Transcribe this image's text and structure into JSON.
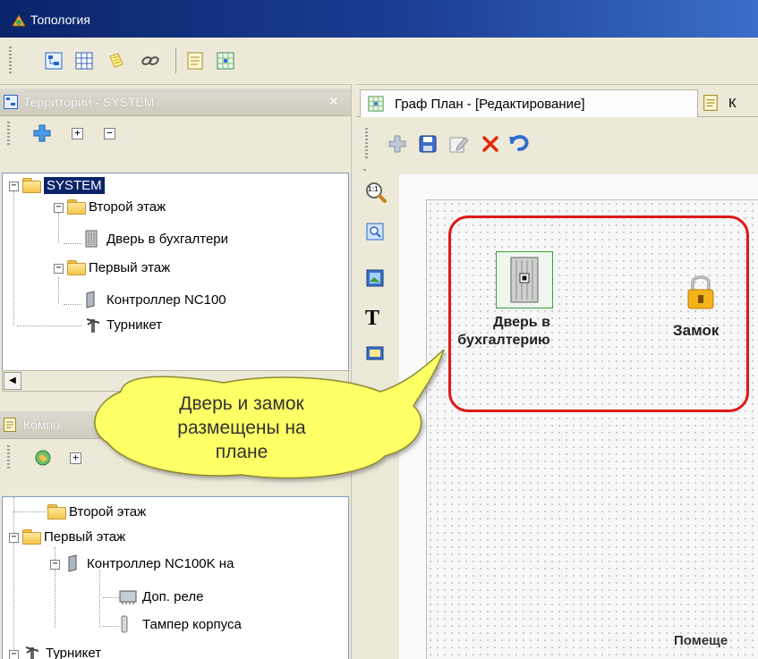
{
  "app": {
    "title": "Топология"
  },
  "territories_panel": {
    "title": "Территории - SYSTEM",
    "close": "×",
    "tree": [
      {
        "label": "SYSTEM",
        "selected": true
      },
      {
        "label": "Второй этаж"
      },
      {
        "label": "Дверь в бухгалтери"
      },
      {
        "label": "Первый этаж"
      },
      {
        "label": "Контроллер NC100"
      },
      {
        "label": "Турникет"
      }
    ]
  },
  "components_panel": {
    "title": "Компо",
    "tree": [
      {
        "label": "Второй этаж"
      },
      {
        "label": "Первый этаж"
      },
      {
        "label": "Контроллер NC100K на"
      },
      {
        "label": "Доп. реле"
      },
      {
        "label": "Тампер корпуса"
      },
      {
        "label": "Турникет"
      }
    ]
  },
  "graph": {
    "tabs": [
      {
        "label": "Граф План - [Редактирование]"
      },
      {
        "label": "К"
      }
    ],
    "side_tools": {
      "zoom_label": "1:1",
      "text_tool": "T"
    },
    "objects": {
      "door_label_1": "Дверь в",
      "door_label_2": "бухгалтерию",
      "lock_label": "Замок",
      "room_label": "Помеще"
    }
  },
  "callout": {
    "line1": "Дверь и замок",
    "line2": "размещены на",
    "line3": "плане"
  },
  "colors": {
    "title_bar": "#0a246a",
    "highlight_box": "#e01818",
    "callout_fill": "#ffff66"
  }
}
